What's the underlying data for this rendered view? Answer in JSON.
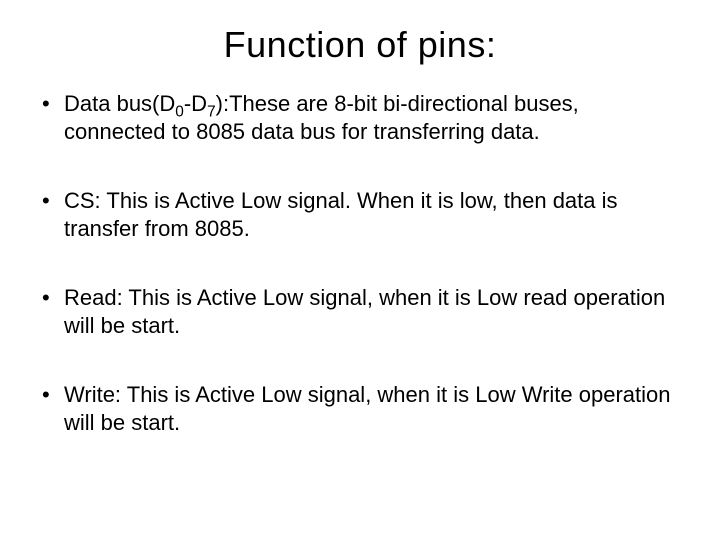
{
  "title": "Function of pins:",
  "items": [
    {
      "prefix": "Data bus(D",
      "sub1": "0",
      "mid": "-D",
      "sub2": "7",
      "rest": "):These are 8-bit bi-directional buses, connected to 8085 data bus for transferring data."
    },
    {
      "text": "CS: This is Active Low signal. When it is low, then data is transfer from 8085."
    },
    {
      "text": "Read: This is Active Low signal, when it is Low read operation will be start."
    },
    {
      "text": "Write: This is Active Low signal, when it is Low Write operation will be start."
    }
  ]
}
